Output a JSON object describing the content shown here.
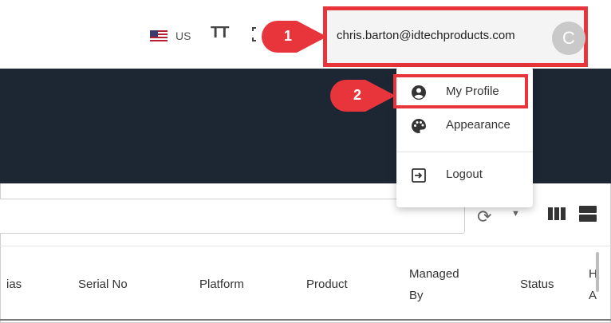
{
  "topbar": {
    "locale_label": "US",
    "text_size_glyph": "TT",
    "user_email": "chris.barton@idtechproducts.com",
    "avatar_initial": "C"
  },
  "callouts": [
    {
      "number": "1"
    },
    {
      "number": "2"
    }
  ],
  "toolbar": {
    "search_placeholder": ""
  },
  "table": {
    "headers": [
      "ias",
      "Serial No",
      "Platform",
      "Product",
      "Managed",
      "By",
      "Status",
      "H",
      "A"
    ]
  },
  "user_menu": {
    "items": [
      {
        "label": "My Profile",
        "icon": "account-circle-icon"
      },
      {
        "label": "Appearance",
        "icon": "palette-icon"
      },
      {
        "label": "Logout",
        "icon": "logout-icon"
      }
    ]
  },
  "colors": {
    "annotation_red": "#e8343b",
    "header_dark": "#1c2733",
    "avatar_gray": "#c9c9c9"
  }
}
